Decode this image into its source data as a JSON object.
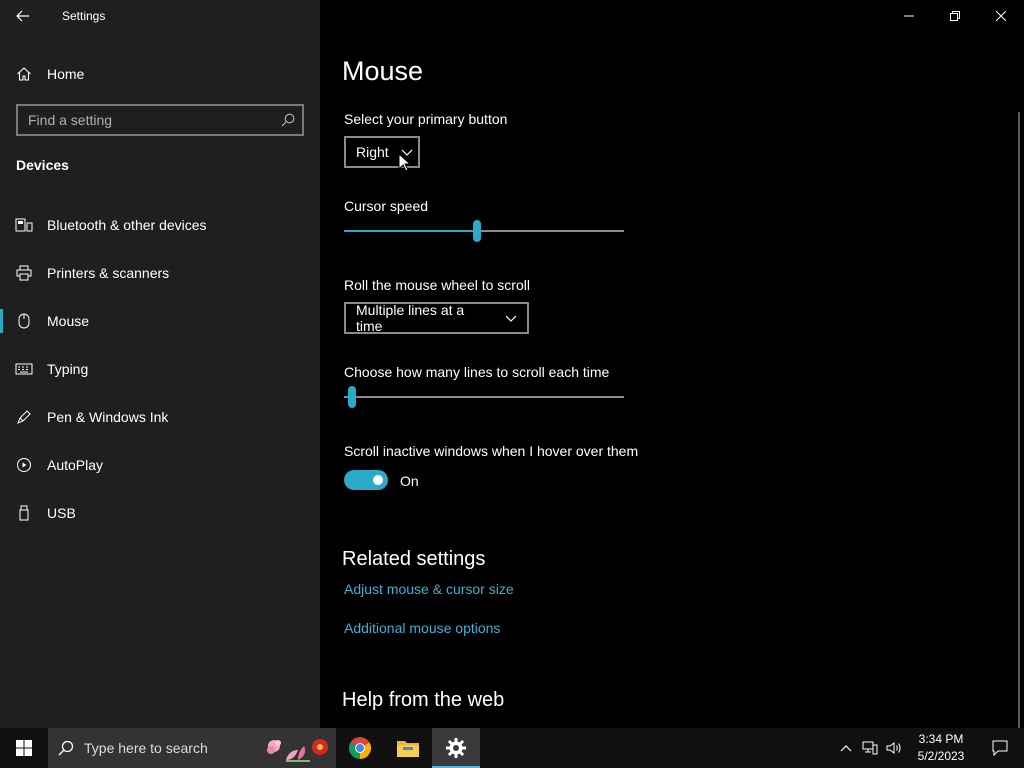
{
  "window": {
    "app_title": "Settings",
    "controls": {
      "minimize": "minimize-icon",
      "restore": "restore-icon",
      "close": "close-icon"
    }
  },
  "sidebar": {
    "home_label": "Home",
    "search_placeholder": "Find a setting",
    "section_title": "Devices",
    "items": [
      {
        "label": "Bluetooth & other devices",
        "icon": "bluetooth-devices-icon",
        "selected": false
      },
      {
        "label": "Printers & scanners",
        "icon": "printer-icon",
        "selected": false
      },
      {
        "label": "Mouse",
        "icon": "mouse-icon",
        "selected": true
      },
      {
        "label": "Typing",
        "icon": "keyboard-icon",
        "selected": false
      },
      {
        "label": "Pen & Windows Ink",
        "icon": "pen-icon",
        "selected": false
      },
      {
        "label": "AutoPlay",
        "icon": "autoplay-icon",
        "selected": false
      },
      {
        "label": "USB",
        "icon": "usb-icon",
        "selected": false
      }
    ]
  },
  "main": {
    "title": "Mouse",
    "primary_button": {
      "label": "Select your primary button",
      "value": "Right"
    },
    "cursor_speed": {
      "label": "Cursor speed",
      "value_fraction": 0.475
    },
    "wheel_scroll": {
      "label": "Roll the mouse wheel to scroll",
      "value": "Multiple lines at a time"
    },
    "lines_to_scroll": {
      "label": "Choose how many lines to scroll each time",
      "value_fraction": 0.03
    },
    "scroll_inactive": {
      "label": "Scroll inactive windows when I hover over them",
      "state": "On"
    },
    "related": {
      "title": "Related settings",
      "links": [
        "Adjust mouse & cursor size",
        "Additional mouse options"
      ]
    },
    "help_title": "Help from the web"
  },
  "taskbar": {
    "search_text": "Type here to search",
    "apps": [
      "chrome-icon",
      "file-explorer-icon",
      "settings-icon"
    ],
    "active_app": "settings-icon",
    "time": "3:34 PM",
    "date": "5/2/2023"
  },
  "colors": {
    "accent": "#2aa9c9",
    "link": "#3fb0d3",
    "sidebar_bg": "#1f1f1f",
    "main_bg": "#000000"
  }
}
